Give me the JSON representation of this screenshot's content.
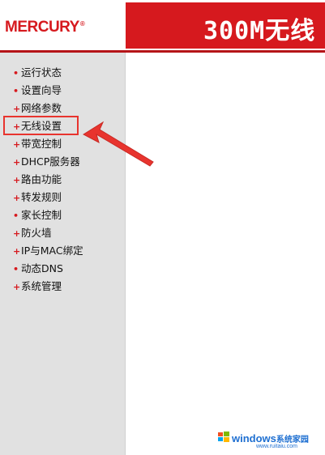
{
  "brand": {
    "logo_text": "MERCURY",
    "logo_mark": "®"
  },
  "header": {
    "title": "300M无线"
  },
  "sidebar": {
    "items": [
      {
        "label": "运行状态",
        "bullet": "•"
      },
      {
        "label": "设置向导",
        "bullet": "•"
      },
      {
        "label": "网络参数",
        "bullet": "+"
      },
      {
        "label": "无线设置",
        "bullet": "+"
      },
      {
        "label": "带宽控制",
        "bullet": "+"
      },
      {
        "label": "DHCP服务器",
        "bullet": "+"
      },
      {
        "label": "路由功能",
        "bullet": "+"
      },
      {
        "label": "转发规则",
        "bullet": "+"
      },
      {
        "label": "家长控制",
        "bullet": "•"
      },
      {
        "label": "防火墙",
        "bullet": "+"
      },
      {
        "label": "IP与MAC绑定",
        "bullet": "+"
      },
      {
        "label": "动态DNS",
        "bullet": "•"
      },
      {
        "label": "系统管理",
        "bullet": "+"
      }
    ]
  },
  "watermark": {
    "brand": "windows",
    "suffix": "系统家园",
    "url": "www.ruitaiu.com"
  },
  "colors": {
    "brand_red": "#d6191e",
    "sidebar_bg": "#e1e1e1",
    "annotation_red": "#e8342e",
    "watermark_blue": "#1e6fd1"
  }
}
